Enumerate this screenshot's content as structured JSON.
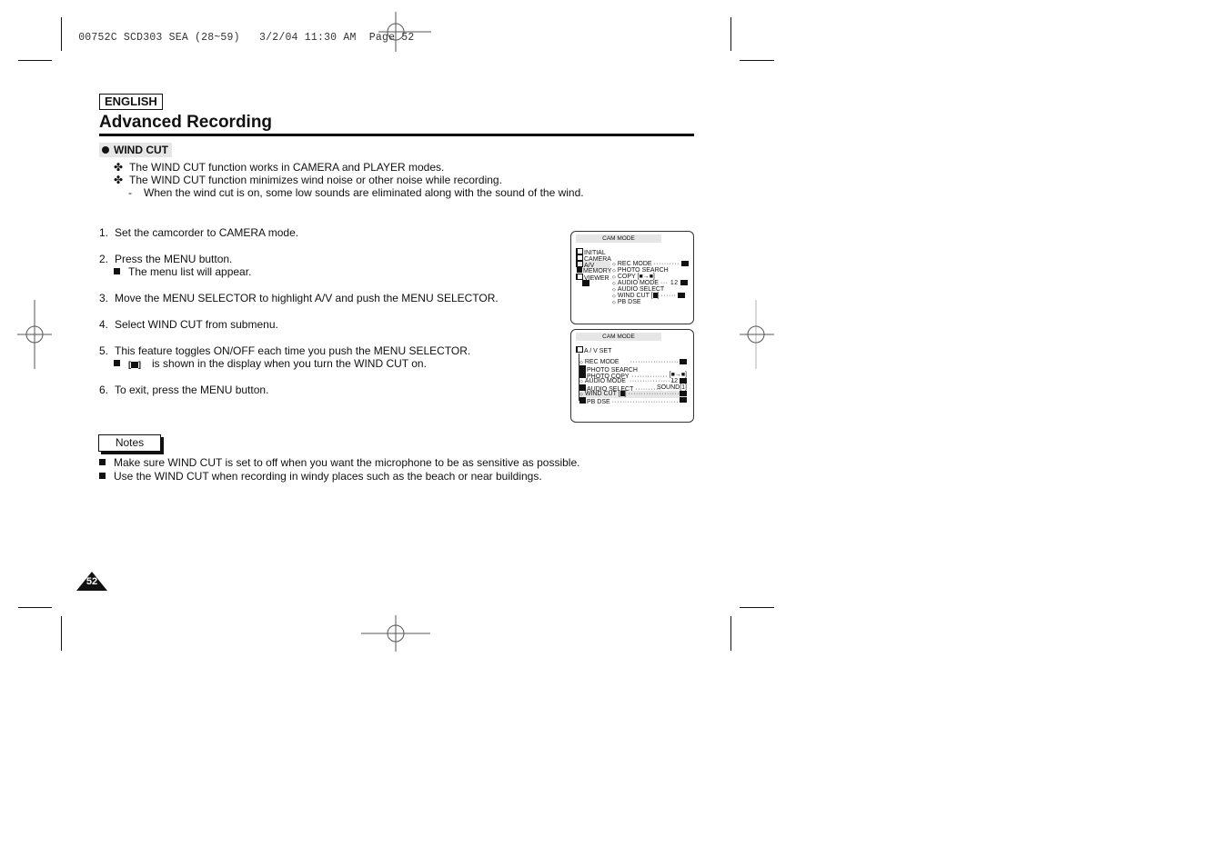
{
  "print_header": {
    "job_id": "00752C SCD303 SEA (28~59)",
    "date": "3/2/04",
    "time": "11:30 AM",
    "page_label": "Page 52"
  },
  "language_badge": "ENGLISH",
  "page_title": "Advanced Recording",
  "section": {
    "heading": "WIND CUT",
    "bullets": [
      "The WIND CUT function works in CAMERA and PLAYER modes.",
      "The WIND CUT function minimizes wind noise or other noise while recording."
    ],
    "sub_bullets": [
      "When the wind cut is on, some low sounds are eliminated along with the sound of the wind."
    ],
    "bullet_glyph": "✤",
    "sub_glyph": "-"
  },
  "steps": [
    {
      "num": "1.",
      "text": "Set the camcorder to CAMERA mode."
    },
    {
      "num": "2.",
      "text": "Press the MENU button.",
      "sub": "The menu list will appear."
    },
    {
      "num": "3.",
      "text": "Move the MENU SELECTOR to highlight A/V and push the MENU SELECTOR."
    },
    {
      "num": "4.",
      "text": "Select WIND CUT from submenu."
    },
    {
      "num": "5.",
      "text": "This feature toggles ON/OFF each time you push the MENU SELECTOR.",
      "sub": "is shown in the display when you turn the WIND CUT on."
    },
    {
      "num": "6.",
      "text": "To exit, press the MENU button."
    }
  ],
  "notes": {
    "label": "Notes",
    "items": [
      "Make sure WIND CUT is set to off when you want the microphone to be as sensitive as possible.",
      "Use the WIND CUT when recording in windy places such as the beach or near buildings."
    ]
  },
  "page_number": "52",
  "screen1": {
    "mode": "CAM  MODE",
    "menu": [
      "INITIAL",
      "CAMERA",
      "A/V",
      "MEMORY",
      "VIEWER"
    ],
    "selected_menu": "A/V",
    "submenu": [
      {
        "label": "REC MODE",
        "value": "··········"
      },
      {
        "label": "PHOTO SEARCH",
        "value": ""
      },
      {
        "label": "COPY",
        "value": "[■→■]"
      },
      {
        "label": "AUDIO MODE",
        "value": "··· 12"
      },
      {
        "label": "AUDIO SELECT",
        "value": ""
      },
      {
        "label": "WIND CUT",
        "value": "······"
      },
      {
        "label": "PB DSE",
        "value": ""
      }
    ]
  },
  "screen2": {
    "mode": "CAM  MODE",
    "title": "A / V SET",
    "items": [
      {
        "label": "REC MODE",
        "value": ""
      },
      {
        "label": "PHOTO SEARCH",
        "value": ""
      },
      {
        "label": "PHOTO COPY",
        "value": "[■→■]"
      },
      {
        "label": "AUDIO MODE",
        "value": "12"
      },
      {
        "label": "AUDIO SELECT",
        "value": "SOUND[1]"
      },
      {
        "label": "WIND CUT",
        "value": ""
      },
      {
        "label": "PB DSE",
        "value": ""
      }
    ],
    "selected_item": "WIND CUT"
  }
}
